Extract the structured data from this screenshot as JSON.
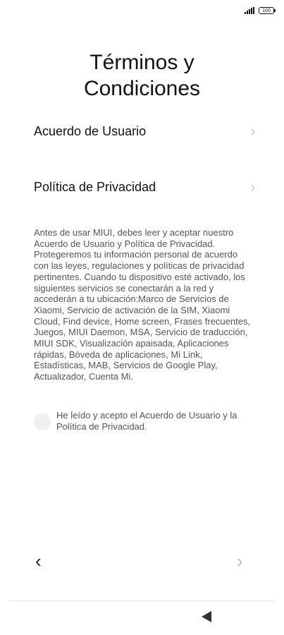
{
  "status_bar": {
    "battery_level": "100",
    "signal_icon": "signal-bars-icon"
  },
  "title": {
    "line1": "Términos y",
    "line2": "Condiciones"
  },
  "menu": [
    {
      "label": "Acuerdo de Usuario",
      "icon": "chevron-right-icon"
    },
    {
      "label": "Política de Privacidad",
      "icon": "chevron-right-icon"
    }
  ],
  "body_text": "Antes de usar MIUI, debes leer y aceptar nuestro Acuerdo de Usuario y Política de Privacidad. Protegeremos tu información personal de acuerdo con las leyes, regulaciones y políticas de privacidad pertinentes. Cuando tu dispositivo esté activado, los siguientes servicios se conectarán a la red y accederán a tu ubicación:Marco de Servicios de Xiaomi, Servicio de activación de la SIM, Xiaomi Cloud, Find device, Home screen, Frases frecuentes, Juegos, MIUI Daemon, MSA, Servicio de traducción, MIUI SDK, Visualización apaisada, Aplicaciones rápidas, Bóveda de aplicaciones, Mi Link, Estadísticas, MAB, Servicios de Google Play, Actualizador, Cuenta Mi.",
  "agree": {
    "label": "He leído y acepto el Acuerdo de Usuario y la Política de Privacidad.",
    "checked": false
  },
  "nav": {
    "back_icon": "chevron-left-icon",
    "next_icon": "chevron-right-icon"
  },
  "system_nav": {
    "back_icon": "triangle-back-icon"
  }
}
